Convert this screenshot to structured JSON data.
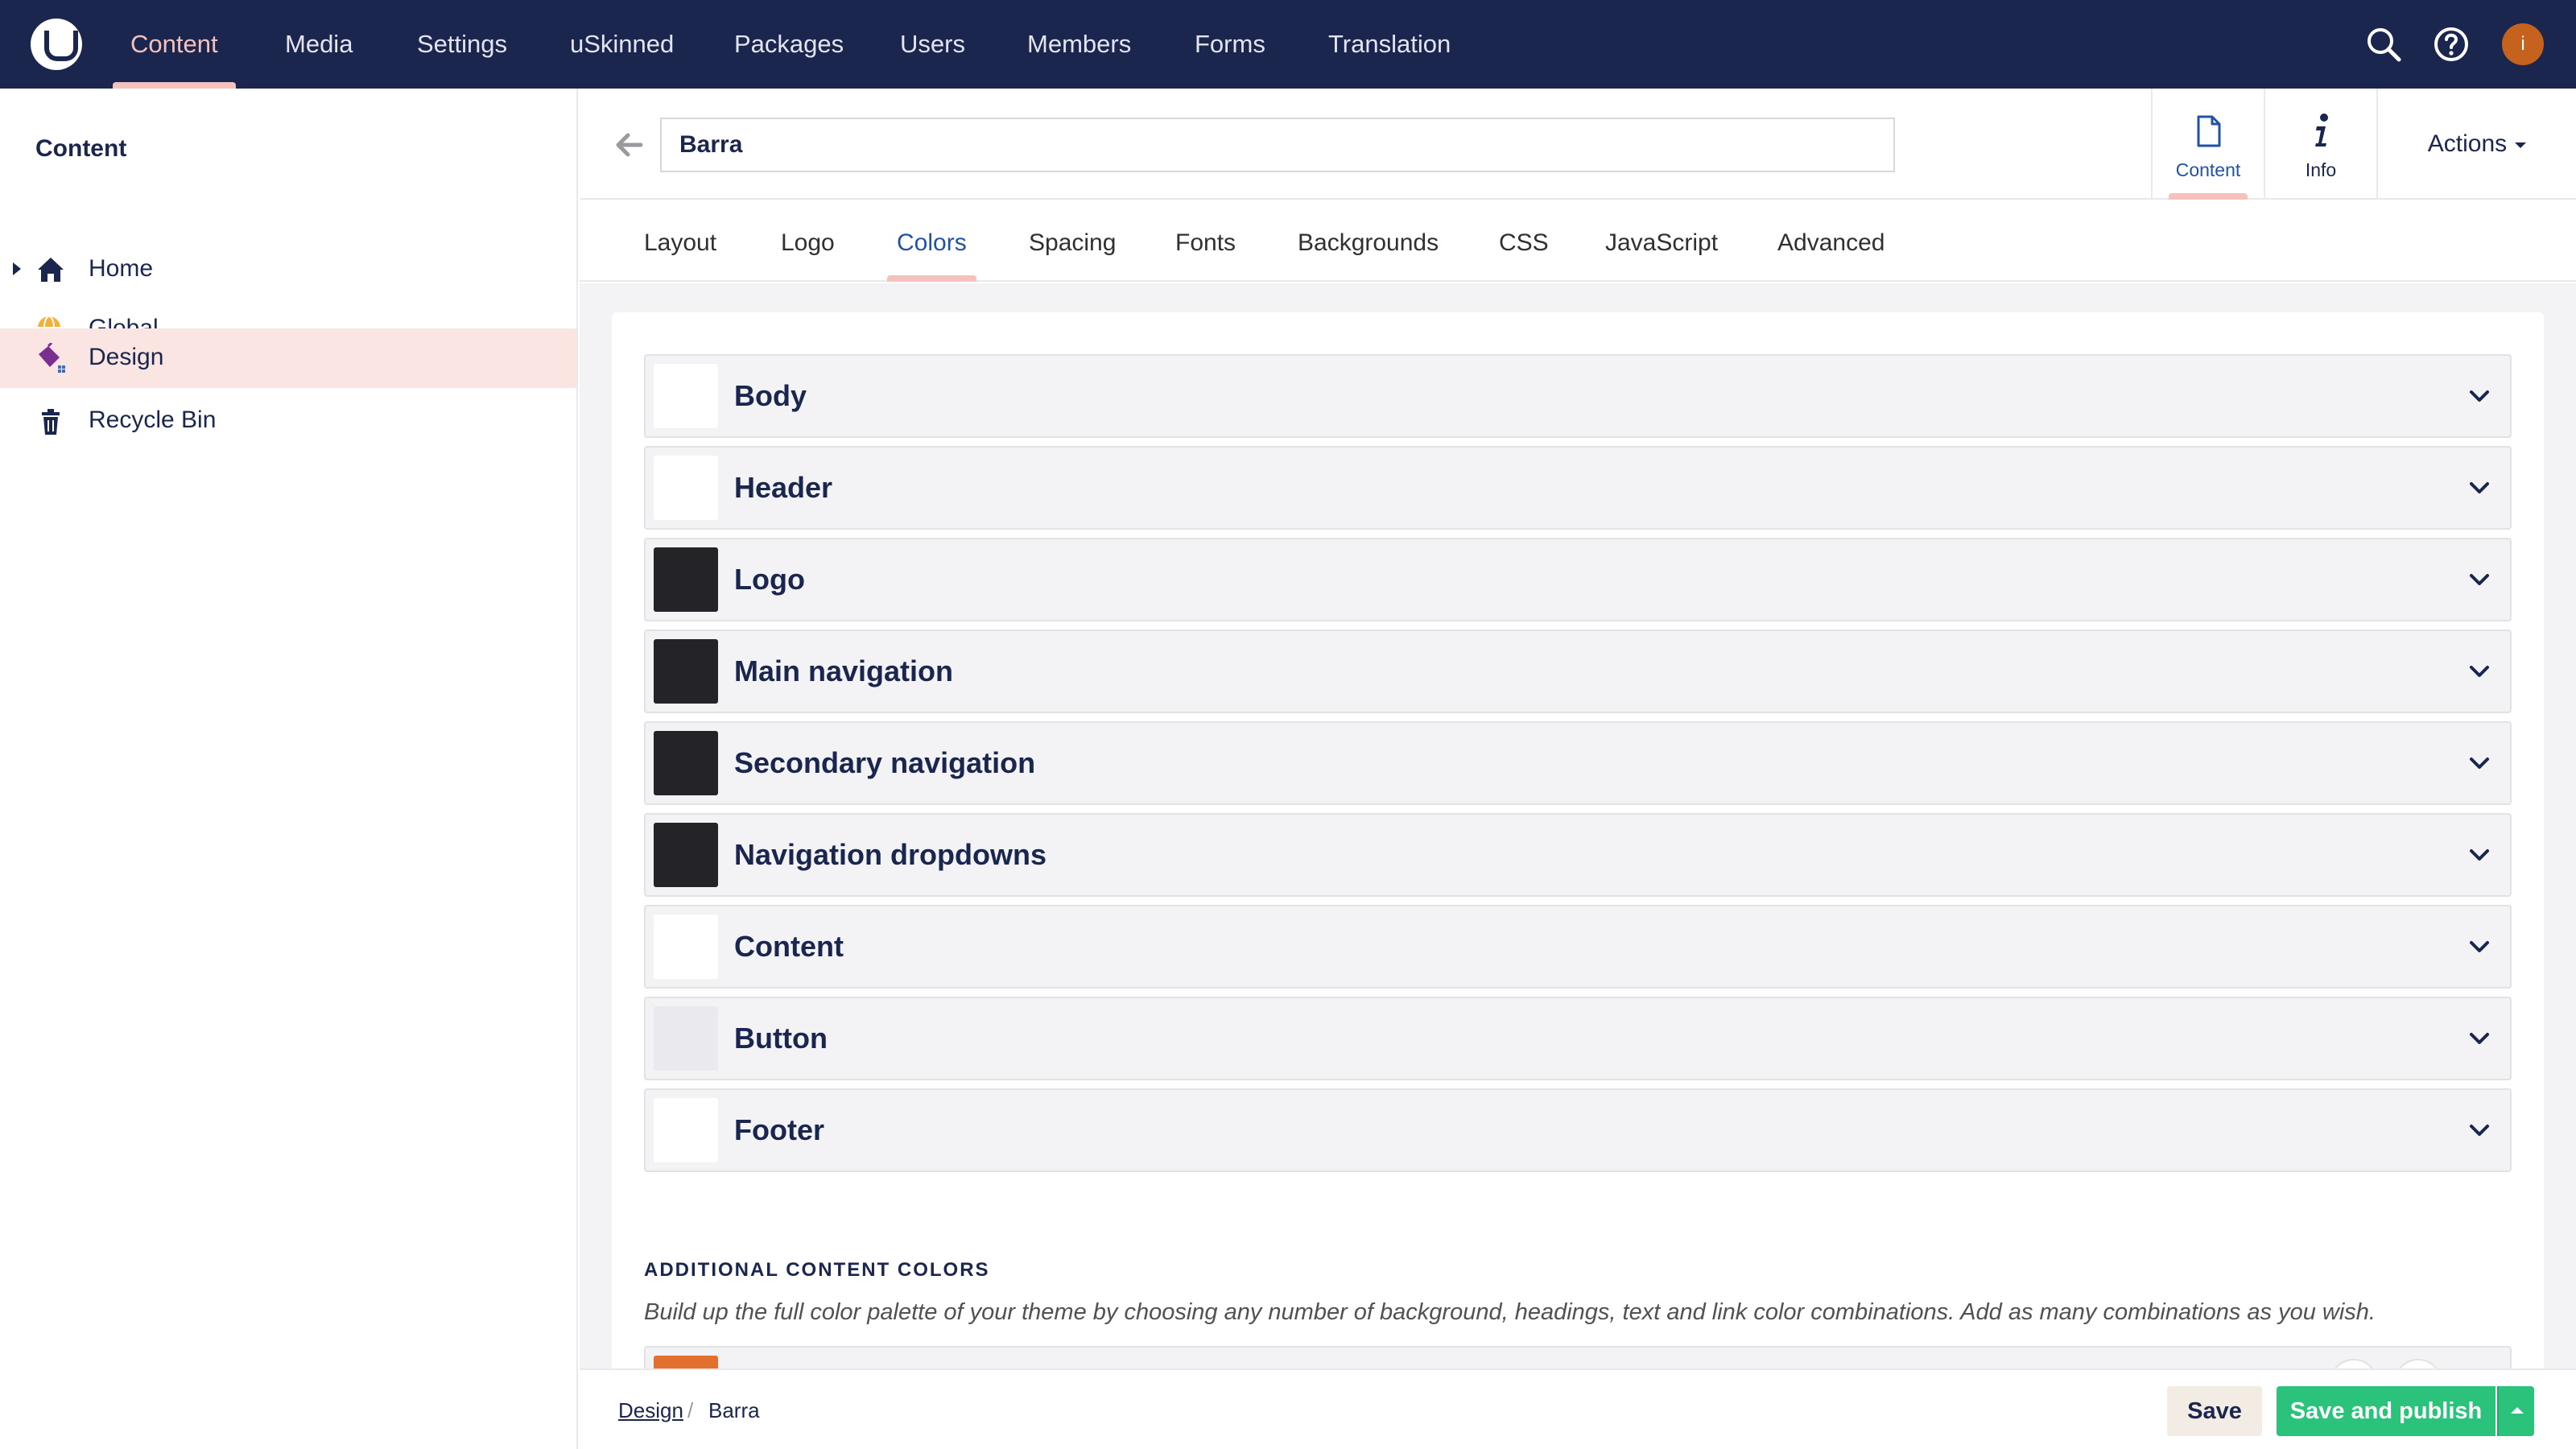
{
  "top_nav": {
    "items": [
      {
        "label": "Content",
        "active": true
      },
      {
        "label": "Media"
      },
      {
        "label": "Settings"
      },
      {
        "label": "uSkinned"
      },
      {
        "label": "Packages"
      },
      {
        "label": "Users"
      },
      {
        "label": "Members"
      },
      {
        "label": "Forms"
      },
      {
        "label": "Translation"
      }
    ],
    "icons": [
      "search-icon",
      "help-icon",
      "user-avatar"
    ],
    "avatar_initial": "i"
  },
  "sidebar": {
    "title": "Content",
    "items": [
      {
        "label": "Home",
        "icon": "home-icon",
        "expandable": true
      },
      {
        "label": "Global",
        "icon": "globe-icon"
      },
      {
        "label": "Design",
        "icon": "paint-bucket-icon",
        "active": true
      },
      {
        "label": "Recycle Bin",
        "icon": "trash-icon"
      }
    ]
  },
  "editor": {
    "node_name": "Barra",
    "apps": [
      {
        "label": "Content",
        "icon": "document-icon",
        "active": true
      },
      {
        "label": "Info",
        "icon": "info-icon"
      }
    ],
    "actions_label": "Actions",
    "tabs": [
      "Layout",
      "Logo",
      "Colors",
      "Spacing",
      "Fonts",
      "Backgrounds",
      "CSS",
      "JavaScript",
      "Advanced"
    ],
    "active_tab": "Colors"
  },
  "color_sections": [
    {
      "label": "Body",
      "swatch": "#ffffff"
    },
    {
      "label": "Header",
      "swatch": "#ffffff"
    },
    {
      "label": "Logo",
      "swatch": "#232328"
    },
    {
      "label": "Main navigation",
      "swatch": "#232328"
    },
    {
      "label": "Secondary navigation",
      "swatch": "#232328"
    },
    {
      "label": "Navigation dropdowns",
      "swatch": "#232328"
    },
    {
      "label": "Content",
      "swatch": "#ffffff"
    },
    {
      "label": "Button",
      "swatch": "#e9e9ee"
    },
    {
      "label": "Footer",
      "swatch": "#ffffff"
    }
  ],
  "additional_colors": {
    "title": "ADDITIONAL CONTENT COLORS",
    "description": "Build up the full color palette of your theme by choosing any number of background, headings, text and link color combinations. Add as many combinations as you wish.",
    "first_swatch": "#e4702f"
  },
  "footer": {
    "breadcrumb": {
      "link": "Design",
      "separator": "/",
      "current": "Barra"
    },
    "save_label": "Save",
    "publish_label": "Save and publish"
  },
  "colors": {
    "topbar": "#1b264f",
    "accent": "#f5c1bc",
    "active_blue": "#2152a3",
    "publish_green": "#2bc37c",
    "sidebar_active": "#fbe5e3"
  }
}
